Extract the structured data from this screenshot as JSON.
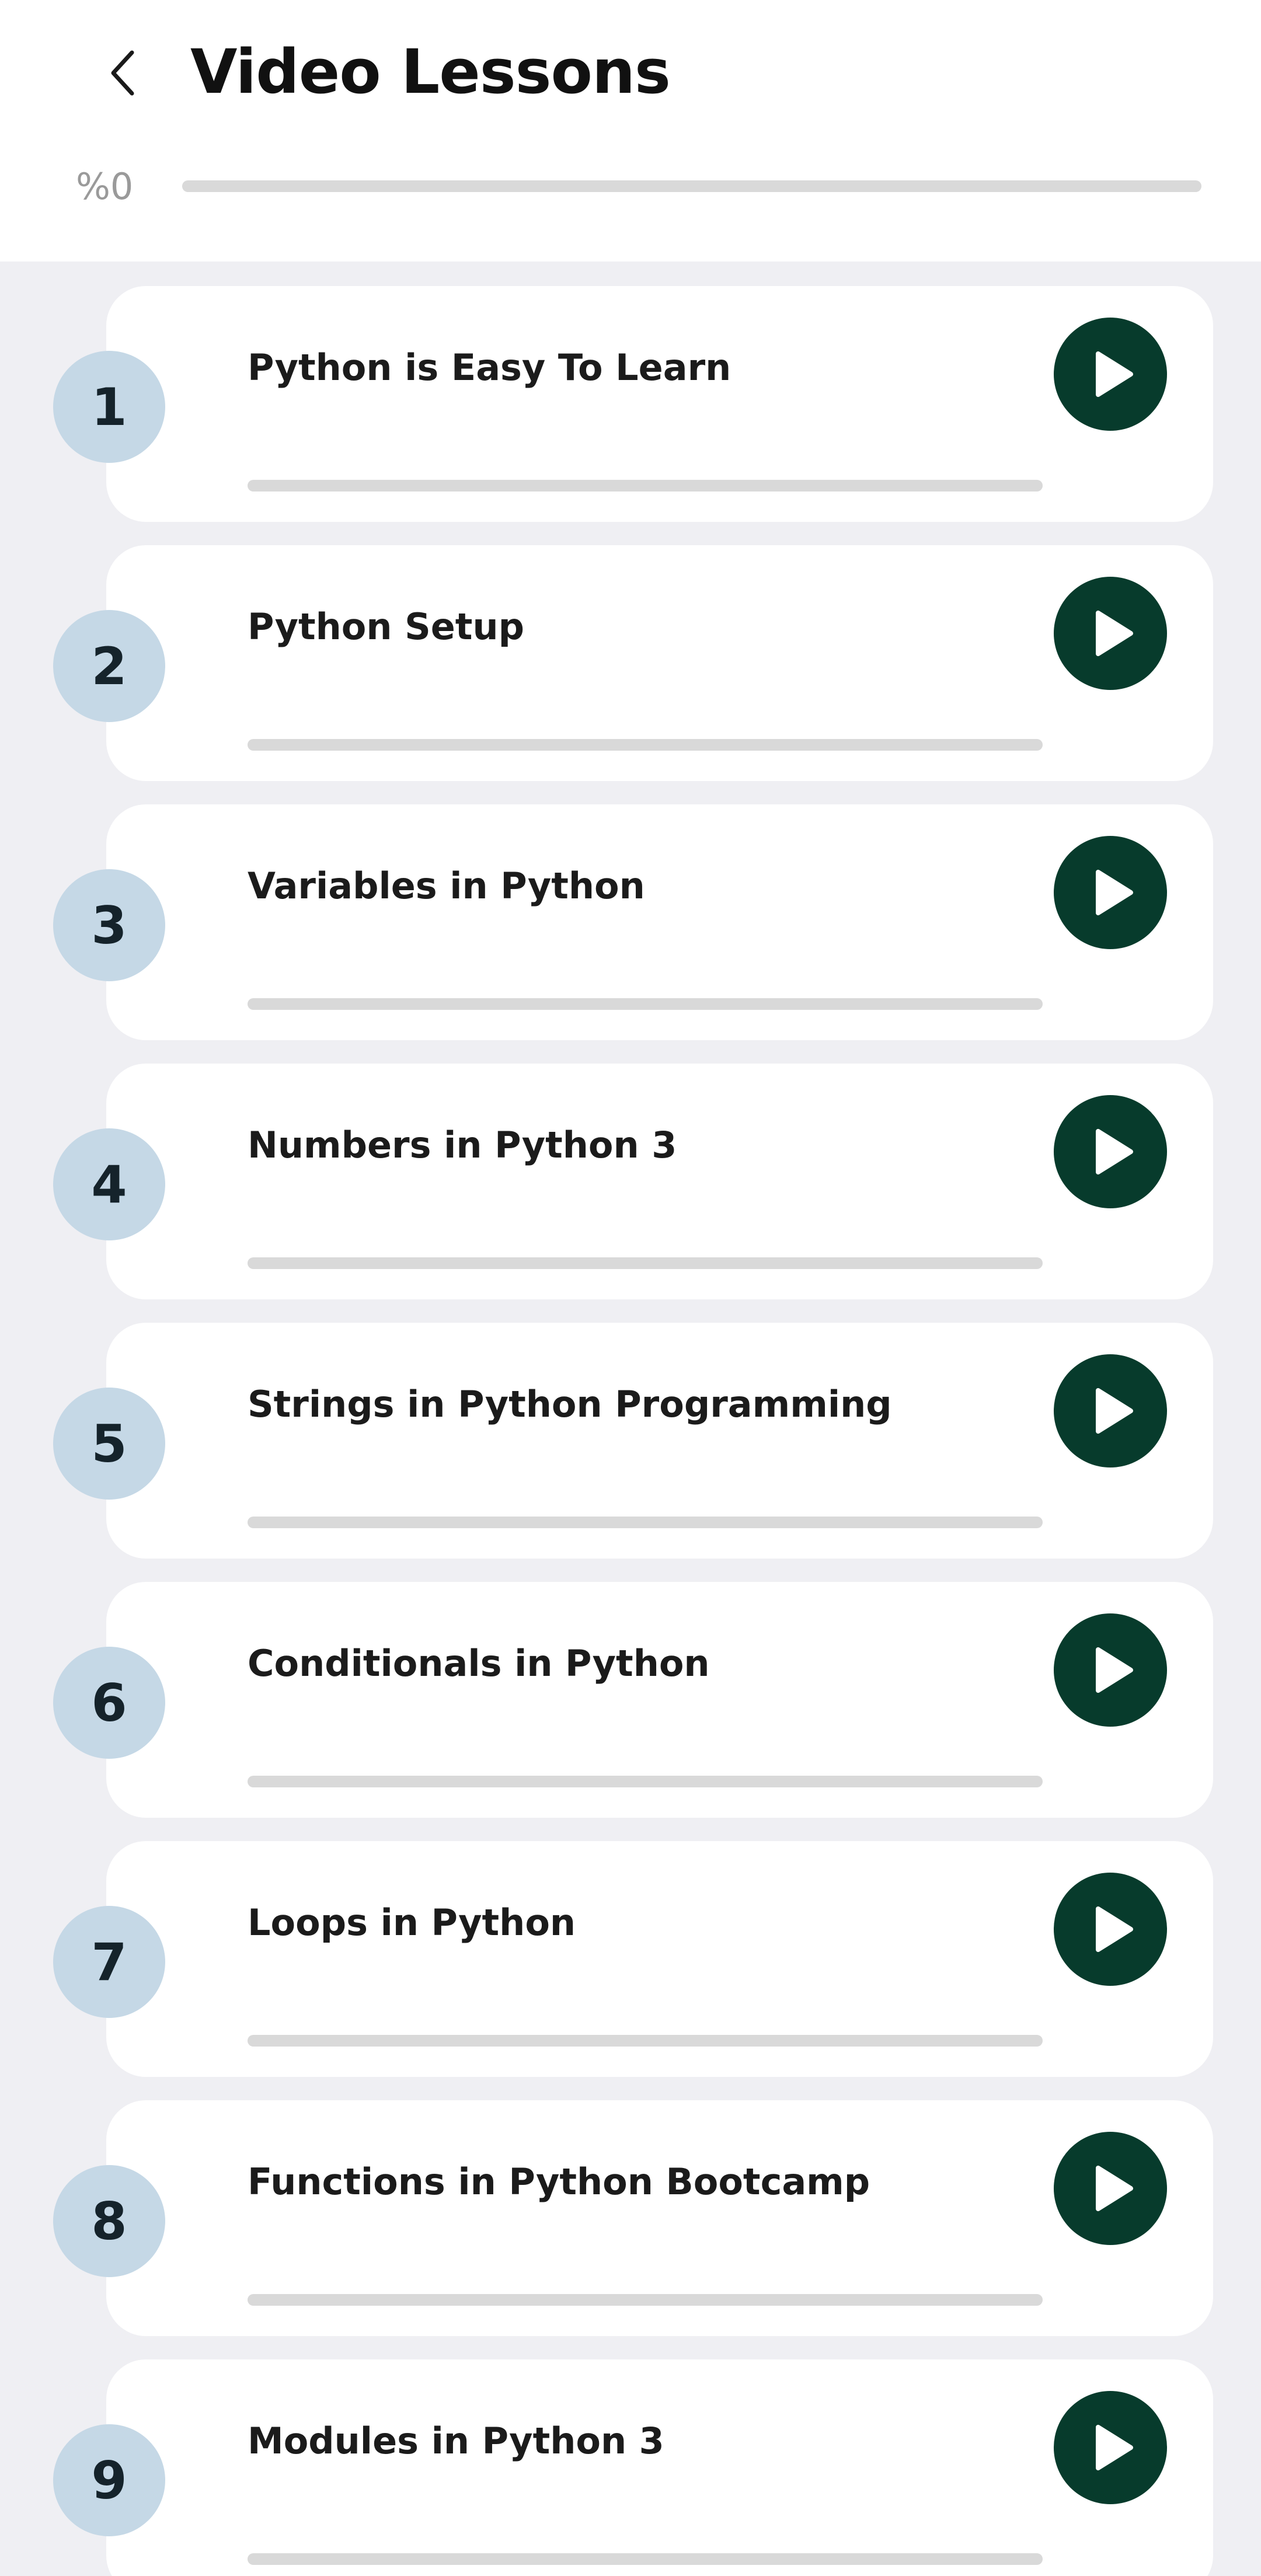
{
  "header": {
    "title": "Video Lessons",
    "back_icon": "chevron-left-icon",
    "overall_progress_label": "%0",
    "overall_progress": 0
  },
  "colors": {
    "accent": "#073b2c",
    "badge_bg": "#c5d8e6",
    "track": "#d9d9d9",
    "page_bg": "#efeff3"
  },
  "lessons": [
    {
      "number": "1",
      "title": "Python is Easy To Learn",
      "progress": 0,
      "icon": "play-icon"
    },
    {
      "number": "2",
      "title": "Python Setup",
      "progress": 0,
      "icon": "play-icon"
    },
    {
      "number": "3",
      "title": "Variables in Python",
      "progress": 0,
      "icon": "play-icon"
    },
    {
      "number": "4",
      "title": "Numbers in Python 3",
      "progress": 0,
      "icon": "play-icon"
    },
    {
      "number": "5",
      "title": "Strings in Python Programming",
      "progress": 0,
      "icon": "play-icon"
    },
    {
      "number": "6",
      "title": "Conditionals in Python",
      "progress": 0,
      "icon": "play-icon"
    },
    {
      "number": "7",
      "title": "Loops in Python",
      "progress": 0,
      "icon": "play-icon"
    },
    {
      "number": "8",
      "title": "Functions in Python Bootcamp",
      "progress": 0,
      "icon": "play-icon"
    },
    {
      "number": "9",
      "title": "Modules in Python 3",
      "progress": 0,
      "icon": "play-icon"
    }
  ]
}
